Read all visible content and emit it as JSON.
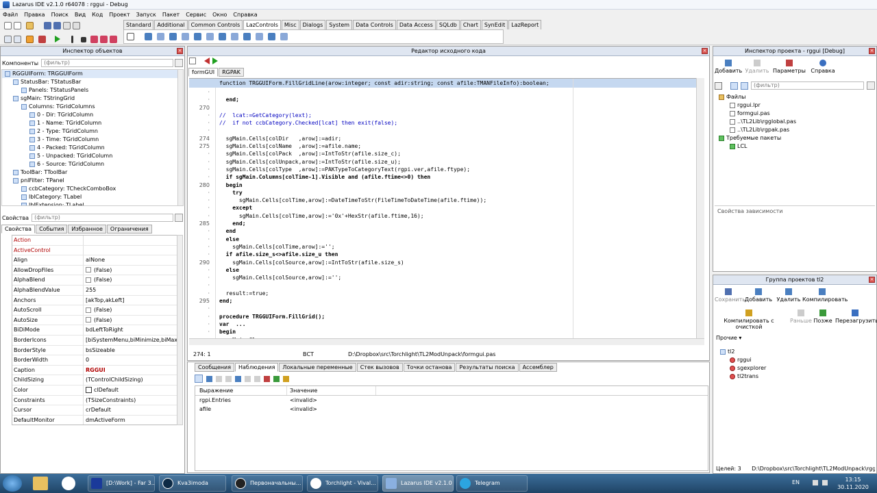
{
  "window": {
    "title": "Lazarus IDE v2.1.0 r64078 : rggui - Debug"
  },
  "menu": [
    "Файл",
    "Правка",
    "Поиск",
    "Вид",
    "Код",
    "Проект",
    "Запуск",
    "Пакет",
    "Сервис",
    "Окно",
    "Справка"
  ],
  "palette": {
    "tabs": [
      "Standard",
      "Additional",
      "Common Controls",
      "LazControls",
      "Misc",
      "Dialogs",
      "System",
      "Data Controls",
      "Data Access",
      "SQLdb",
      "Chart",
      "SynEdit",
      "LazReport"
    ],
    "active_tab": "LazControls"
  },
  "object_inspector": {
    "title": "Инспектор объектов",
    "components_label": "Компоненты",
    "filter_placeholder": "(фильтр)",
    "tree": [
      {
        "label": "RGGUIForm: TRGGUIForm",
        "level": 0
      },
      {
        "label": "StatusBar: TStatusBar",
        "level": 1
      },
      {
        "label": "Panels: TStatusPanels",
        "level": 2
      },
      {
        "label": "sgMain: TStringGrid",
        "level": 1
      },
      {
        "label": "Columns: TGridColumns",
        "level": 2
      },
      {
        "label": "0 - Dir: TGridColumn",
        "level": 3
      },
      {
        "label": "1 - Name: TGridColumn",
        "level": 3
      },
      {
        "label": "2 - Type: TGridColumn",
        "level": 3
      },
      {
        "label": "3 - Time: TGridColumn",
        "level": 3
      },
      {
        "label": "4 - Packed: TGridColumn",
        "level": 3
      },
      {
        "label": "5 - Unpacked: TGridColumn",
        "level": 3
      },
      {
        "label": "6 - Source: TGridColumn",
        "level": 3
      },
      {
        "label": "ToolBar: TToolBar",
        "level": 1
      },
      {
        "label": "pnlFilter: TPanel",
        "level": 1
      },
      {
        "label": "ccbCategory: TCheckComboBox",
        "level": 2
      },
      {
        "label": "lblCategory: TLabel",
        "level": 2
      },
      {
        "label": "lblExtension: TLabel",
        "level": 2
      }
    ],
    "props_label": "Свойства",
    "prop_tabs": [
      "Свойства",
      "События",
      "Избранное",
      "Ограничения"
    ],
    "properties": [
      {
        "name": "Action",
        "value": "",
        "red": true
      },
      {
        "name": "ActiveControl",
        "value": "",
        "red": true
      },
      {
        "name": "Align",
        "value": "alNone"
      },
      {
        "name": "AllowDropFiles",
        "value": "(False)",
        "check": true
      },
      {
        "name": "AlphaBlend",
        "value": "(False)",
        "check": true
      },
      {
        "name": "AlphaBlendValue",
        "value": "255"
      },
      {
        "name": "Anchors",
        "value": "[akTop,akLeft]"
      },
      {
        "name": "AutoScroll",
        "value": "(False)",
        "check": true
      },
      {
        "name": "AutoSize",
        "value": "(False)",
        "check": true
      },
      {
        "name": "BiDiMode",
        "value": "bdLeftToRight"
      },
      {
        "name": "BorderIcons",
        "value": "[biSystemMenu,biMinimize,biMaxim"
      },
      {
        "name": "BorderStyle",
        "value": "bsSizeable"
      },
      {
        "name": "BorderWidth",
        "value": "0"
      },
      {
        "name": "Caption",
        "value": "RGGUI"
      },
      {
        "name": "ChildSizing",
        "value": "(TControlChildSizing)"
      },
      {
        "name": "Color",
        "value": "clDefault",
        "swatch": true
      },
      {
        "name": "Constraints",
        "value": "(TSizeConstraints)"
      },
      {
        "name": "Cursor",
        "value": "crDefault"
      },
      {
        "name": "DefaultMonitor",
        "value": "dmActiveForm"
      }
    ]
  },
  "editor": {
    "title": "Редактор исходного кода",
    "tabs": [
      "formGUI",
      "RGPAK"
    ],
    "header_line": "function TRGGUIForm.FillGridLine(arow:integer; const adir:string; const afile:TMANFileInfo):boolean;",
    "lines": [
      {
        "n": "",
        "t": ""
      },
      {
        "n": "",
        "t": "  end;"
      },
      {
        "n": "270",
        "t": ""
      },
      {
        "n": "",
        "t": "//  lcat:=GetCategory(lext);"
      },
      {
        "n": "",
        "t": "//  if not ccbCategory.Checked[lcat] then exit(false);"
      },
      {
        "n": "",
        "t": ""
      },
      {
        "n": "274",
        "t": "  sgMain.Cells[colDir   ,arow]:=adir;"
      },
      {
        "n": "275",
        "t": "  sgMain.Cells[colName  ,arow]:=afile.name;"
      },
      {
        "n": "",
        "t": "  sgMain.Cells[colPack  ,arow]:=IntToStr(afile.size_c);"
      },
      {
        "n": "",
        "t": "  sgMain.Cells[colUnpack,arow]:=IntToStr(afile.size_u);"
      },
      {
        "n": "",
        "t": "  sgMain.Cells[colType  ,arow]:=PAKTypeToCategoryText(rgpi.ver,afile.ftype);"
      },
      {
        "n": "",
        "t": "  if sgMain.Columns[colTime-1].Visible and (afile.ftime<>0) then"
      },
      {
        "n": "280",
        "t": "  begin"
      },
      {
        "n": "",
        "t": "    try"
      },
      {
        "n": "",
        "t": "      sgMain.Cells[colTime,arow]:=DateTimeToStr(FileTimeToDateTime(afile.ftime));"
      },
      {
        "n": "",
        "t": "    except"
      },
      {
        "n": "",
        "t": "      sgMain.Cells[colTime,arow]:='0x'+HexStr(afile.ftime,16);"
      },
      {
        "n": "285",
        "t": "    end;"
      },
      {
        "n": "",
        "t": "  end"
      },
      {
        "n": "",
        "t": "  else"
      },
      {
        "n": "",
        "t": "    sgMain.Cells[colTime,arow]:='';"
      },
      {
        "n": "",
        "t": "  if afile.size_s<>afile.size_u then"
      },
      {
        "n": "290",
        "t": "    sgMain.Cells[colSource,arow]:=IntToStr(afile.size_s)"
      },
      {
        "n": "",
        "t": "  else"
      },
      {
        "n": "",
        "t": "    sgMain.Cells[colSource,arow]:='';"
      },
      {
        "n": "",
        "t": ""
      },
      {
        "n": "",
        "t": "  result:=true;"
      },
      {
        "n": "295",
        "t": "end;"
      },
      {
        "n": "",
        "t": ""
      },
      {
        "n": "",
        "t": "procedure TRGGUIForm.FillGrid();"
      },
      {
        "n": "",
        "t": "var  ..."
      },
      {
        "n": "",
        "t": "begin"
      },
      {
        "n": "",
        "t": "  sgMain.Clear;"
      }
    ],
    "status": {
      "pos": "274:  1",
      "mode": "ВСТ",
      "file": "D:\\Dropbox\\src\\Torchlight\\TL2ModUnpack\\formgui.pas"
    }
  },
  "messages": {
    "tabs": [
      "Сообщения",
      "Наблюдения",
      "Локальные переменные",
      "Стек вызовов",
      "Точки останова",
      "Результаты поиска",
      "Ассемблер"
    ],
    "active_tab": "Наблюдения",
    "columns": [
      "Выражение",
      "Значение"
    ],
    "rows": [
      {
        "expr": "rgpi.Entries",
        "val": "<invalid>"
      },
      {
        "expr": "afile",
        "val": "<invalid>"
      }
    ]
  },
  "project_inspector": {
    "title": "Инспектор проекта - rggui [Debug]",
    "buttons": [
      "Добавить",
      "Удалить",
      "Параметры",
      "Справка"
    ],
    "filter_placeholder": "(фильтр)",
    "files_label": "Файлы",
    "files": [
      "rggui.lpr",
      "formgui.pas",
      "..\\TL2Lib\\rgglobal.pas",
      "..\\TL2Lib\\rgpak.pas"
    ],
    "packages_label": "Требуемые пакеты",
    "packages": [
      "LCL"
    ],
    "deps_label": "Свойства зависимости"
  },
  "project_group": {
    "title": "Группа проектов tl2",
    "buttons_row1": [
      "Сохранить",
      "Добавить",
      "Удалить",
      "Компилировать"
    ],
    "buttons_row2": [
      "Компилировать с очисткой",
      "Раньше",
      "Позже",
      "Перезагрузить"
    ],
    "other": "Прочие",
    "root": "tl2",
    "items": [
      "rggui",
      "sgexplorer",
      "tl2trans"
    ],
    "status_left": "Целей: 3",
    "status_right": "D:\\Dropbox\\src\\Torchlight\\TL2ModUnpack\\rggui.l"
  },
  "taskbar": {
    "tasks": [
      "[D:\\Work] - Far 3...",
      "Kva3imoda",
      "Первоначальны...",
      "Torchlight - Vival...",
      "Lazarus IDE v2.1.0 ...",
      "Telegram"
    ],
    "lang": "EN",
    "time": "13:15",
    "date": "30.11.2020"
  }
}
